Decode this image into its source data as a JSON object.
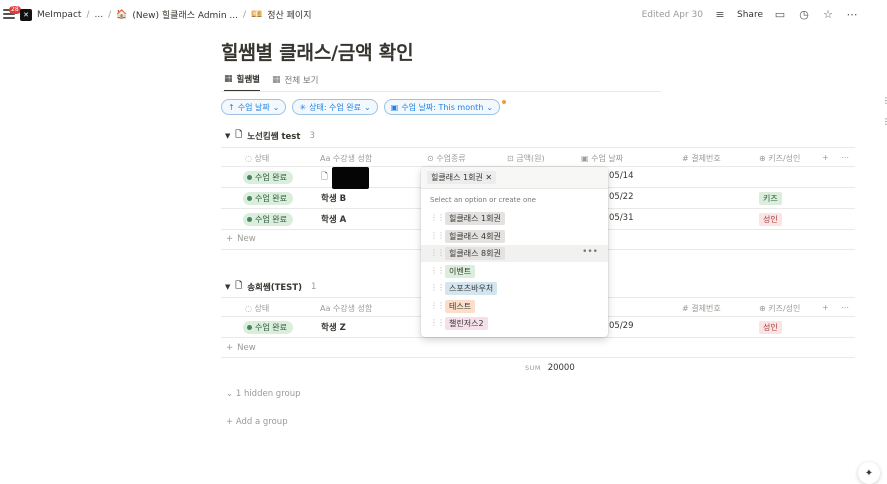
{
  "topbar": {
    "badge": "28",
    "workspace": "MeImpact",
    "sep": "/",
    "ellipsis": "...",
    "crumb2": "(New) 힐클래스 Admin ...",
    "crumb3": "정산 페이지",
    "edited": "Edited Apr 30",
    "share": "Share"
  },
  "page": {
    "title": "힐쌤별 클래스/금액 확인",
    "tabs": [
      {
        "label": "힐쌤별"
      },
      {
        "label": "전체 보기"
      }
    ],
    "filters": [
      {
        "label": "수업 날짜"
      },
      {
        "label": "상태: 수업 완료"
      },
      {
        "label": "수업 날짜: This month"
      }
    ]
  },
  "columns": {
    "status": "상태",
    "student": "수강생 성함",
    "class_type": "수업종류",
    "amount": "금액(원)",
    "date": "수업 날짜",
    "pay_no": "결제번호",
    "kids_adult": "키즈/성인"
  },
  "groups": [
    {
      "name": "노선킴쌤 test",
      "count": "3",
      "rows": [
        {
          "status": "수업 완료",
          "student": "",
          "date": "05/14",
          "kids": ""
        },
        {
          "status": "수업 완료",
          "student": "학생 B",
          "date": "05/22",
          "kids": "키즈"
        },
        {
          "status": "수업 완료",
          "student": "학생 A",
          "date": "05/31",
          "kids": "성인"
        }
      ]
    },
    {
      "name": "송희쌤(TEST)",
      "count": "1",
      "rows": [
        {
          "status": "수업 완료",
          "student": "학생 Z",
          "date": "05/29",
          "kids": "성인"
        }
      ]
    }
  ],
  "new_label": "New",
  "sum": {
    "label": "SUM",
    "value": "20000"
  },
  "hidden_group": "1 hidden group",
  "add_group": "Add a group",
  "dropdown": {
    "selected": "힐클래스 1회권",
    "hint": "Select an option or create one",
    "options": [
      {
        "label": "힐클래스 1회권",
        "color": "#e3e2e0"
      },
      {
        "label": "힐클래스 4회권",
        "color": "#e3e2e0"
      },
      {
        "label": "힐클래스 8회권",
        "color": "#e3e2e0"
      },
      {
        "label": "이벤트",
        "color": "#dbeddb"
      },
      {
        "label": "스포츠바우처",
        "color": "#d3e5ef"
      },
      {
        "label": "테스트",
        "color": "#fadec9"
      },
      {
        "label": "챌린저스2",
        "color": "#f4dfeb"
      }
    ]
  }
}
